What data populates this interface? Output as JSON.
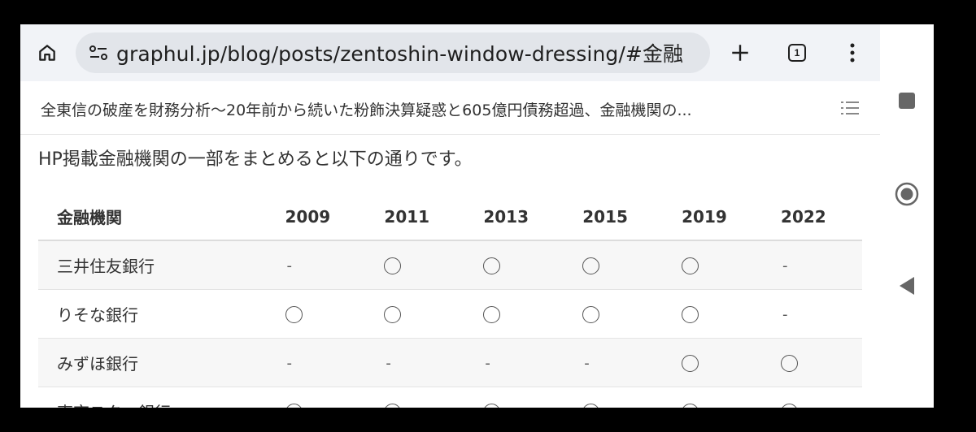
{
  "browser": {
    "url_host": "graphul.jp",
    "url_path": "/blog/posts/zentoshin-window-dressing/#金融",
    "tab_count": "1"
  },
  "toc": {
    "title": "全東信の破産を財務分析〜20年前から続いた粉飾決算疑惑と605億円債務超過、金融機関の..."
  },
  "article": {
    "intro": "HP掲載金融機関の一部をまとめると以下の通りです。"
  },
  "table": {
    "headers": [
      "金融機関",
      "2009",
      "2011",
      "2013",
      "2015",
      "2019",
      "2022"
    ],
    "rows": [
      {
        "name": "三井住友銀行",
        "cells": [
          "-",
          "○",
          "○",
          "○",
          "○",
          "-"
        ]
      },
      {
        "name": "りそな銀行",
        "cells": [
          "○",
          "○",
          "○",
          "○",
          "○",
          "-"
        ]
      },
      {
        "name": "みずほ銀行",
        "cells": [
          "-",
          "-",
          "-",
          "-",
          "○",
          "○"
        ]
      },
      {
        "name": "東京スター銀行",
        "cells": [
          "○",
          "○",
          "○",
          "○",
          "○",
          "○"
        ]
      }
    ]
  },
  "colors": {
    "toolbar_bg": "#f1f3f7",
    "omnibox_bg": "#e2e5ea",
    "text": "#333333"
  }
}
